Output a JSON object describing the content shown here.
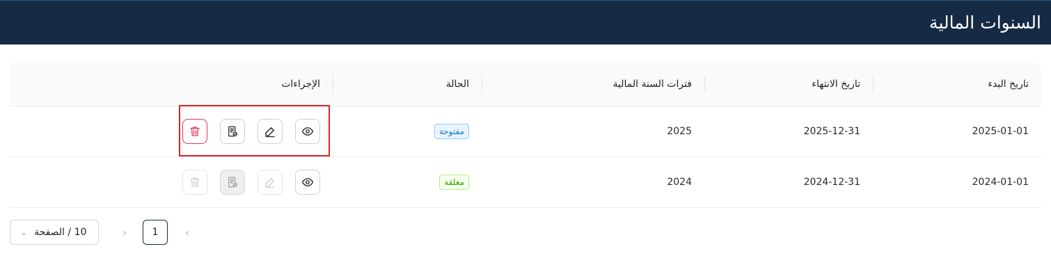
{
  "header": {
    "title": "السنوات المالية"
  },
  "table": {
    "columns": {
      "start_date": "تاريخ البدء",
      "end_date": "تاريخ الانتهاء",
      "periods": "فترات السنة المالية",
      "status": "الحالة",
      "actions": "الإجراءات"
    },
    "rows": [
      {
        "start_date": "2025-01-01",
        "end_date": "2025-12-31",
        "periods": "2025",
        "status": "مفتوحة",
        "status_type": "open",
        "actions_enabled": true
      },
      {
        "start_date": "2024-01-01",
        "end_date": "2024-12-31",
        "periods": "2024",
        "status": "مغلقة",
        "status_type": "closed",
        "actions_enabled": false
      }
    ],
    "action_icons": [
      "eye-icon",
      "edit-icon",
      "close-period-icon",
      "delete-icon"
    ]
  },
  "pagination": {
    "current_page": "1",
    "page_size_label": "10 / الصفحة",
    "prev_icon": "chevron-left-icon",
    "next_icon": "chevron-right-icon"
  },
  "colors": {
    "header_bg": "#152a43",
    "open_tag": "#1677c9",
    "closed_tag": "#389e0d",
    "danger": "#e0355a",
    "highlight": "#e0201e"
  }
}
